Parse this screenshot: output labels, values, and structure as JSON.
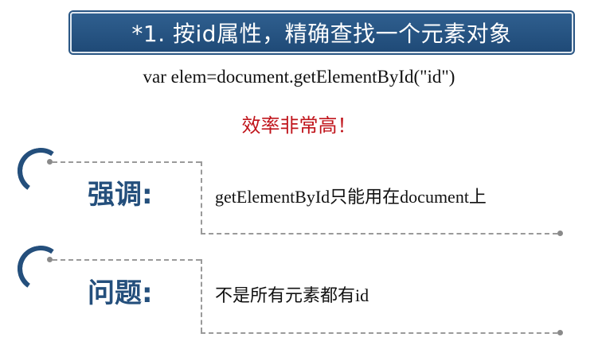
{
  "title": "*1. 按id属性，精确查找一个元素对象",
  "code": "var elem=document.getElementById(\"id\")",
  "highlight": "效率非常高！",
  "colors": {
    "title_bg": "#1f4a77",
    "label": "#244f7c",
    "highlight": "#c0141b"
  },
  "sections": [
    {
      "label": "强调:",
      "text": "getElementById只能用在document上",
      "icon": "bracket-arc-icon"
    },
    {
      "label": "问题:",
      "text": "不是所有元素都有id",
      "icon": "bracket-arc-icon"
    }
  ]
}
